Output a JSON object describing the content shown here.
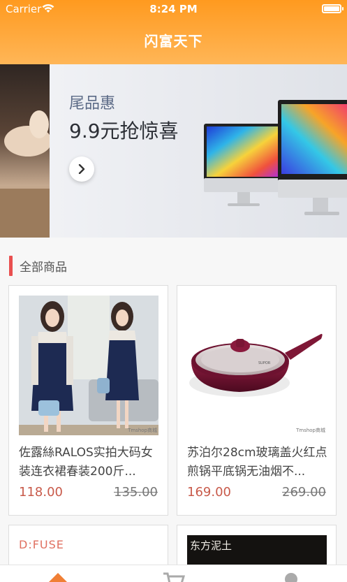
{
  "status_bar": {
    "carrier": "Carrier",
    "time": "8:24 PM"
  },
  "nav": {
    "title": "闪富天下"
  },
  "banner": {
    "subtitle": "尾品惠",
    "headline": "9.9元抢惊喜"
  },
  "section": {
    "title": "全部商品"
  },
  "products": [
    {
      "name": "佐露絲RALOS实拍大码女装连衣裙春装200斤...",
      "price": "118.00",
      "old_price": "135.00",
      "watermark": "Tmshop商城"
    },
    {
      "name": "苏泊尔28cm玻璃盖火红点煎锅平底锅无油烟不...",
      "price": "169.00",
      "old_price": "269.00",
      "watermark": "Tmshop商城"
    },
    {
      "brand": "D:FUSE"
    },
    {
      "brand": "东方泥土"
    }
  ],
  "colors": {
    "header_top": "#ff9a1f",
    "header_bottom": "#ffb657",
    "accent_bar": "#e94f4f",
    "price": "#c85a4a",
    "tab_active": "#f07f35"
  },
  "tabbar": {
    "items": [
      "home-icon",
      "cart-icon",
      "profile-icon"
    ]
  }
}
